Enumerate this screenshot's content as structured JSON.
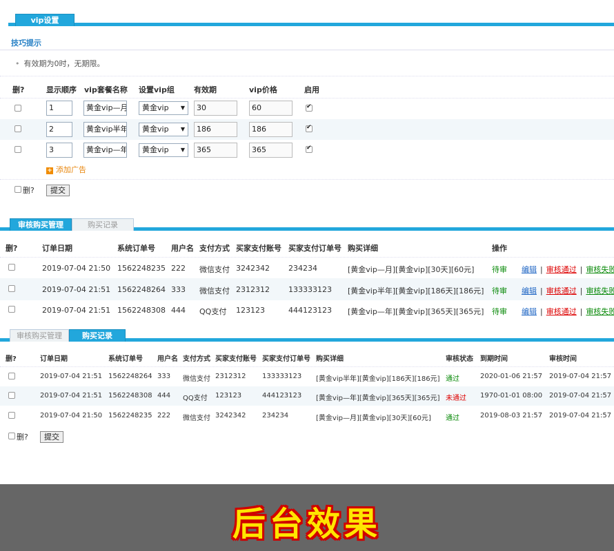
{
  "vip_settings": {
    "tab_label": "vip设置",
    "hint_title": "技巧提示",
    "hint_text": "有效期为0时，无期限。",
    "headers": {
      "del": "删?",
      "order": "显示顺序",
      "name": "vip套餐名称",
      "group": "设置vip组",
      "period": "有效期",
      "price": "vip价格",
      "enabled": "启用"
    },
    "rows": [
      {
        "order": "1",
        "name": "黄金vip—月",
        "group": "黄金vip",
        "period": "30",
        "price": "60",
        "enabled": true
      },
      {
        "order": "2",
        "name": "黄金vip半年",
        "group": "黄金vip",
        "period": "186",
        "price": "186",
        "enabled": true
      },
      {
        "order": "3",
        "name": "黄金vip—年",
        "group": "黄金vip",
        "period": "365",
        "price": "365",
        "enabled": true
      }
    ],
    "add_label": "添加广告",
    "del_label": "删?",
    "submit_label": "提交"
  },
  "review": {
    "tabs": [
      "审核购买管理",
      "购买记录"
    ],
    "headers": {
      "del": "删?",
      "date": "订单日期",
      "order_no": "系统订单号",
      "user": "用户名",
      "pay": "支付方式",
      "account": "买家支付账号",
      "buyer_order": "买家支付订单号",
      "detail": "购买详细",
      "action": "操作"
    },
    "rows": [
      {
        "date": "2019-07-04 21:50",
        "order_no": "1562248235",
        "user": "222",
        "pay": "微信支付",
        "account": "3242342",
        "buyer_order": "234234",
        "detail": "[黄金vip—月][黄金vip][30天][60元]"
      },
      {
        "date": "2019-07-04 21:51",
        "order_no": "1562248264",
        "user": "333",
        "pay": "微信支付",
        "account": "2312312",
        "buyer_order": "133333123",
        "detail": "[黄金vip半年][黄金vip][186天][186元]"
      },
      {
        "date": "2019-07-04 21:51",
        "order_no": "1562248308",
        "user": "444",
        "pay": "QQ支付",
        "account": "123123",
        "buyer_order": "444123123",
        "detail": "[黄金vip—年][黄金vip][365天][365元]"
      }
    ],
    "ops": {
      "status": "待审",
      "edit": "编辑",
      "pass": "审核通过",
      "fail": "审核失败"
    }
  },
  "records": {
    "tabs": [
      "审核购买管理",
      "购买记录"
    ],
    "headers": {
      "del": "删?",
      "date": "订单日期",
      "order_no": "系统订单号",
      "user": "用户名",
      "pay": "支付方式",
      "account": "买家支付账号",
      "buyer_order": "买家支付订单号",
      "detail": "购买详细",
      "status": "审核状态",
      "expire": "到期时间",
      "review_time": "审核时间"
    },
    "rows": [
      {
        "date": "2019-07-04 21:51",
        "order_no": "1562248264",
        "user": "333",
        "pay": "微信支付",
        "account": "2312312",
        "buyer_order": "133333123",
        "detail": "[黄金vip半年][黄金vip][186天][186元]",
        "status": "通过",
        "expire": "2020-01-06 21:57",
        "review_time": "2019-07-04 21:57"
      },
      {
        "date": "2019-07-04 21:51",
        "order_no": "1562248308",
        "user": "444",
        "pay": "QQ支付",
        "account": "123123",
        "buyer_order": "444123123",
        "detail": "[黄金vip—年][黄金vip][365天][365元]",
        "status": "未通过",
        "expire": "1970-01-01 08:00",
        "review_time": "2019-07-04 21:57"
      },
      {
        "date": "2019-07-04 21:50",
        "order_no": "1562248235",
        "user": "222",
        "pay": "微信支付",
        "account": "3242342",
        "buyer_order": "234234",
        "detail": "[黄金vip—月][黄金vip][30天][60元]",
        "status": "通过",
        "expire": "2019-08-03 21:57",
        "review_time": "2019-07-04 21:57"
      }
    ],
    "del_label": "删?",
    "submit_label": "提交"
  },
  "banner": {
    "text": "后台效果"
  },
  "colors": {
    "accent": "#22a7dc",
    "pass": "#0a8a0a",
    "fail": "#d00000",
    "link": "#1f66c4",
    "banner_bg": "#666666",
    "banner_text": "#ffe600"
  }
}
